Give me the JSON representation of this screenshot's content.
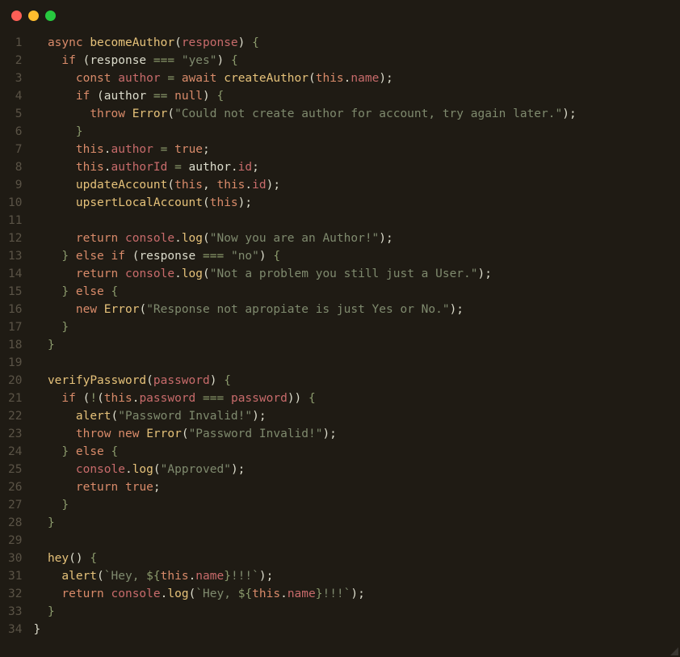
{
  "window": {
    "traffic_lights": [
      "red",
      "yellow",
      "green"
    ]
  },
  "line_count": 34,
  "code_lines": [
    [
      [
        "n",
        "  "
      ],
      [
        "k",
        "async"
      ],
      [
        "n",
        " "
      ],
      [
        "fn",
        "becomeAuthor"
      ],
      [
        "n",
        "("
      ],
      [
        "pr",
        "response"
      ],
      [
        "n",
        ") "
      ],
      [
        "op",
        "{"
      ]
    ],
    [
      [
        "n",
        "    "
      ],
      [
        "k",
        "if"
      ],
      [
        "n",
        " ("
      ],
      [
        "n",
        "response "
      ],
      [
        "op",
        "==="
      ],
      [
        "n",
        " "
      ],
      [
        "s",
        "\"yes\""
      ],
      [
        "n",
        ") "
      ],
      [
        "op",
        "{"
      ]
    ],
    [
      [
        "n",
        "      "
      ],
      [
        "k",
        "const"
      ],
      [
        "n",
        " "
      ],
      [
        "pr",
        "author"
      ],
      [
        "n",
        " "
      ],
      [
        "op",
        "="
      ],
      [
        "n",
        " "
      ],
      [
        "k",
        "await"
      ],
      [
        "n",
        " "
      ],
      [
        "fn",
        "createAuthor"
      ],
      [
        "n",
        "("
      ],
      [
        "k",
        "this"
      ],
      [
        "n",
        "."
      ],
      [
        "pr",
        "name"
      ],
      [
        "n",
        ");"
      ]
    ],
    [
      [
        "n",
        "      "
      ],
      [
        "k",
        "if"
      ],
      [
        "n",
        " ("
      ],
      [
        "n",
        "author "
      ],
      [
        "op",
        "=="
      ],
      [
        "n",
        " "
      ],
      [
        "nm",
        "null"
      ],
      [
        "n",
        ") "
      ],
      [
        "op",
        "{"
      ]
    ],
    [
      [
        "n",
        "        "
      ],
      [
        "k",
        "throw"
      ],
      [
        "n",
        " "
      ],
      [
        "kw2",
        "Error"
      ],
      [
        "n",
        "("
      ],
      [
        "s",
        "\"Could not create author for account, try again later.\""
      ],
      [
        "n",
        ");"
      ]
    ],
    [
      [
        "n",
        "      "
      ],
      [
        "op",
        "}"
      ]
    ],
    [
      [
        "n",
        "      "
      ],
      [
        "k",
        "this"
      ],
      [
        "n",
        "."
      ],
      [
        "pr",
        "author"
      ],
      [
        "n",
        " "
      ],
      [
        "op",
        "="
      ],
      [
        "n",
        " "
      ],
      [
        "nm",
        "true"
      ],
      [
        "n",
        ";"
      ]
    ],
    [
      [
        "n",
        "      "
      ],
      [
        "k",
        "this"
      ],
      [
        "n",
        "."
      ],
      [
        "pr",
        "authorId"
      ],
      [
        "n",
        " "
      ],
      [
        "op",
        "="
      ],
      [
        "n",
        " author."
      ],
      [
        "pr",
        "id"
      ],
      [
        "n",
        ";"
      ]
    ],
    [
      [
        "n",
        "      "
      ],
      [
        "fn",
        "updateAccount"
      ],
      [
        "n",
        "("
      ],
      [
        "k",
        "this"
      ],
      [
        "n",
        ", "
      ],
      [
        "k",
        "this"
      ],
      [
        "n",
        "."
      ],
      [
        "pr",
        "id"
      ],
      [
        "n",
        ");"
      ]
    ],
    [
      [
        "n",
        "      "
      ],
      [
        "fn",
        "upsertLocalAccount"
      ],
      [
        "n",
        "("
      ],
      [
        "k",
        "this"
      ],
      [
        "n",
        ");"
      ]
    ],
    [
      [
        "n",
        ""
      ]
    ],
    [
      [
        "n",
        "      "
      ],
      [
        "k",
        "return"
      ],
      [
        "n",
        " "
      ],
      [
        "pr",
        "console"
      ],
      [
        "n",
        "."
      ],
      [
        "fn",
        "log"
      ],
      [
        "n",
        "("
      ],
      [
        "s",
        "\"Now you are an Author!\""
      ],
      [
        "n",
        ");"
      ]
    ],
    [
      [
        "n",
        "    "
      ],
      [
        "op",
        "}"
      ],
      [
        "n",
        " "
      ],
      [
        "k",
        "else"
      ],
      [
        "n",
        " "
      ],
      [
        "k",
        "if"
      ],
      [
        "n",
        " ("
      ],
      [
        "n",
        "response "
      ],
      [
        "op",
        "==="
      ],
      [
        "n",
        " "
      ],
      [
        "s",
        "\"no\""
      ],
      [
        "n",
        ") "
      ],
      [
        "op",
        "{"
      ]
    ],
    [
      [
        "n",
        "      "
      ],
      [
        "k",
        "return"
      ],
      [
        "n",
        " "
      ],
      [
        "pr",
        "console"
      ],
      [
        "n",
        "."
      ],
      [
        "fn",
        "log"
      ],
      [
        "n",
        "("
      ],
      [
        "s",
        "\"Not a problem you still just a User.\""
      ],
      [
        "n",
        ");"
      ]
    ],
    [
      [
        "n",
        "    "
      ],
      [
        "op",
        "}"
      ],
      [
        "n",
        " "
      ],
      [
        "k",
        "else"
      ],
      [
        "n",
        " "
      ],
      [
        "op",
        "{"
      ]
    ],
    [
      [
        "n",
        "      "
      ],
      [
        "k",
        "new"
      ],
      [
        "n",
        " "
      ],
      [
        "kw2",
        "Error"
      ],
      [
        "n",
        "("
      ],
      [
        "s",
        "\"Response not apropiate is just Yes or No.\""
      ],
      [
        "n",
        ");"
      ]
    ],
    [
      [
        "n",
        "    "
      ],
      [
        "op",
        "}"
      ]
    ],
    [
      [
        "n",
        "  "
      ],
      [
        "op",
        "}"
      ]
    ],
    [
      [
        "n",
        ""
      ]
    ],
    [
      [
        "n",
        "  "
      ],
      [
        "fn",
        "verifyPassword"
      ],
      [
        "n",
        "("
      ],
      [
        "pr",
        "password"
      ],
      [
        "n",
        ") "
      ],
      [
        "op",
        "{"
      ]
    ],
    [
      [
        "n",
        "    "
      ],
      [
        "k",
        "if"
      ],
      [
        "n",
        " ("
      ],
      [
        "op",
        "!"
      ],
      [
        "n",
        "("
      ],
      [
        "k",
        "this"
      ],
      [
        "n",
        "."
      ],
      [
        "pr",
        "password"
      ],
      [
        "n",
        " "
      ],
      [
        "op",
        "==="
      ],
      [
        "n",
        " "
      ],
      [
        "pr",
        "password"
      ],
      [
        "n",
        ")) "
      ],
      [
        "op",
        "{"
      ]
    ],
    [
      [
        "n",
        "      "
      ],
      [
        "fn",
        "alert"
      ],
      [
        "n",
        "("
      ],
      [
        "s",
        "\"Password Invalid!\""
      ],
      [
        "n",
        ");"
      ]
    ],
    [
      [
        "n",
        "      "
      ],
      [
        "k",
        "throw"
      ],
      [
        "n",
        " "
      ],
      [
        "k",
        "new"
      ],
      [
        "n",
        " "
      ],
      [
        "kw2",
        "Error"
      ],
      [
        "n",
        "("
      ],
      [
        "s",
        "\"Password Invalid!\""
      ],
      [
        "n",
        ");"
      ]
    ],
    [
      [
        "n",
        "    "
      ],
      [
        "op",
        "}"
      ],
      [
        "n",
        " "
      ],
      [
        "k",
        "else"
      ],
      [
        "n",
        " "
      ],
      [
        "op",
        "{"
      ]
    ],
    [
      [
        "n",
        "      "
      ],
      [
        "pr",
        "console"
      ],
      [
        "n",
        "."
      ],
      [
        "fn",
        "log"
      ],
      [
        "n",
        "("
      ],
      [
        "s",
        "\"Approved\""
      ],
      [
        "n",
        ");"
      ]
    ],
    [
      [
        "n",
        "      "
      ],
      [
        "k",
        "return"
      ],
      [
        "n",
        " "
      ],
      [
        "nm",
        "true"
      ],
      [
        "n",
        ";"
      ]
    ],
    [
      [
        "n",
        "    "
      ],
      [
        "op",
        "}"
      ]
    ],
    [
      [
        "n",
        "  "
      ],
      [
        "op",
        "}"
      ]
    ],
    [
      [
        "n",
        ""
      ]
    ],
    [
      [
        "n",
        "  "
      ],
      [
        "fn",
        "hey"
      ],
      [
        "n",
        "() "
      ],
      [
        "op",
        "{"
      ]
    ],
    [
      [
        "n",
        "    "
      ],
      [
        "fn",
        "alert"
      ],
      [
        "n",
        "("
      ],
      [
        "s",
        "`Hey, "
      ],
      [
        "op",
        "${"
      ],
      [
        "k",
        "this"
      ],
      [
        "n",
        "."
      ],
      [
        "pr",
        "name"
      ],
      [
        "op",
        "}"
      ],
      [
        "s",
        "!!!`"
      ],
      [
        "n",
        ");"
      ]
    ],
    [
      [
        "n",
        "    "
      ],
      [
        "k",
        "return"
      ],
      [
        "n",
        " "
      ],
      [
        "pr",
        "console"
      ],
      [
        "n",
        "."
      ],
      [
        "fn",
        "log"
      ],
      [
        "n",
        "("
      ],
      [
        "s",
        "`Hey, "
      ],
      [
        "op",
        "${"
      ],
      [
        "k",
        "this"
      ],
      [
        "n",
        "."
      ],
      [
        "pr",
        "name"
      ],
      [
        "op",
        "}"
      ],
      [
        "s",
        "!!!`"
      ],
      [
        "n",
        ");"
      ]
    ],
    [
      [
        "n",
        "  "
      ],
      [
        "op",
        "}"
      ]
    ],
    [
      [
        "n",
        "}"
      ]
    ]
  ]
}
